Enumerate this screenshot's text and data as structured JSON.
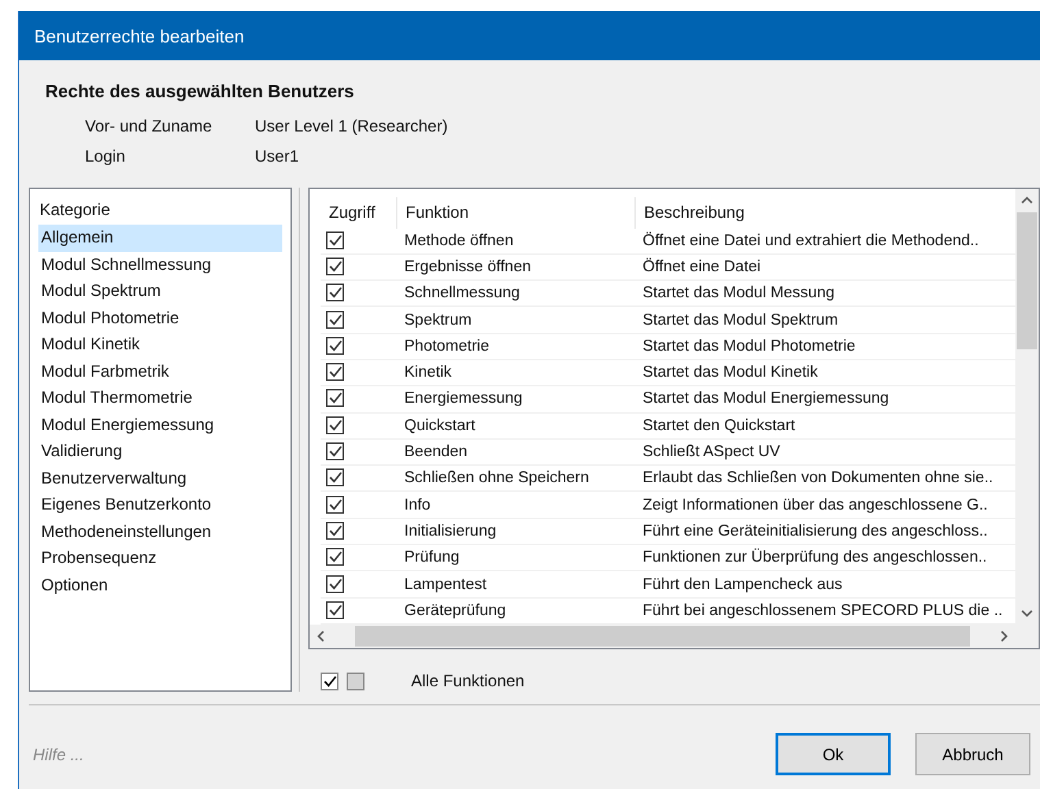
{
  "window": {
    "title": "Benutzerrechte bearbeiten"
  },
  "user": {
    "heading": "Rechte des ausgewählten Benutzers",
    "fields": [
      {
        "label": "Vor- und Zuname",
        "value": "User Level 1 (Researcher)"
      },
      {
        "label": "Login",
        "value": "User1"
      }
    ]
  },
  "categories": {
    "heading": "Kategorie",
    "items": [
      {
        "label": "Allgemein",
        "selected": true
      },
      {
        "label": "Modul Schnellmessung",
        "selected": false
      },
      {
        "label": "Modul Spektrum",
        "selected": false
      },
      {
        "label": "Modul Photometrie",
        "selected": false
      },
      {
        "label": "Modul Kinetik",
        "selected": false
      },
      {
        "label": "Modul Farbmetrik",
        "selected": false
      },
      {
        "label": "Modul Thermometrie",
        "selected": false
      },
      {
        "label": "Modul Energiemessung",
        "selected": false
      },
      {
        "label": "Validierung",
        "selected": false
      },
      {
        "label": "Benutzerverwaltung",
        "selected": false
      },
      {
        "label": "Eigenes Benutzerkonto",
        "selected": false
      },
      {
        "label": "Methodeneinstellungen",
        "selected": false
      },
      {
        "label": "Probensequenz",
        "selected": false
      },
      {
        "label": "Optionen",
        "selected": false
      }
    ]
  },
  "table": {
    "columns": [
      "Zugriff",
      "Funktion",
      "Beschreibung"
    ],
    "rows": [
      {
        "checked": true,
        "function": "Methode öffnen",
        "description": "Öffnet eine Datei und extrahiert die Methodend.."
      },
      {
        "checked": true,
        "function": "Ergebnisse öffnen",
        "description": "Öffnet eine Datei"
      },
      {
        "checked": true,
        "function": "Schnellmessung",
        "description": "Startet das Modul Messung"
      },
      {
        "checked": true,
        "function": "Spektrum",
        "description": "Startet das Modul Spektrum"
      },
      {
        "checked": true,
        "function": "Photometrie",
        "description": "Startet das Modul Photometrie"
      },
      {
        "checked": true,
        "function": "Kinetik",
        "description": "Startet das Modul Kinetik"
      },
      {
        "checked": true,
        "function": "Energiemessung",
        "description": "Startet das Modul Energiemessung"
      },
      {
        "checked": true,
        "function": "Quickstart",
        "description": "Startet den Quickstart"
      },
      {
        "checked": true,
        "function": "Beenden",
        "description": "Schließt ASpect UV"
      },
      {
        "checked": true,
        "function": "Schließen ohne Speichern",
        "description": "Erlaubt das Schließen von Dokumenten ohne sie.."
      },
      {
        "checked": true,
        "function": "Info",
        "description": "Zeigt Informationen über das angeschlossene G.."
      },
      {
        "checked": true,
        "function": "Initialisierung",
        "description": "Führt eine Geräteinitialisierung des angeschloss.."
      },
      {
        "checked": true,
        "function": "Prüfung",
        "description": "Funktionen zur Überprüfung des angeschlossen.."
      },
      {
        "checked": true,
        "function": "Lampentest",
        "description": "Führt den Lampencheck aus"
      },
      {
        "checked": true,
        "function": "Geräteprüfung",
        "description": "Führt bei angeschlossenem SPECORD PLUS die .."
      }
    ]
  },
  "all_functions": {
    "label": "Alle Funktionen",
    "select_all": {
      "checked": true
    },
    "select_none": {
      "checked": false
    }
  },
  "help": "Hilfe ...",
  "buttons": [
    {
      "label": "Ok",
      "default": true
    },
    {
      "label": "Abbruch",
      "default": false
    }
  ]
}
